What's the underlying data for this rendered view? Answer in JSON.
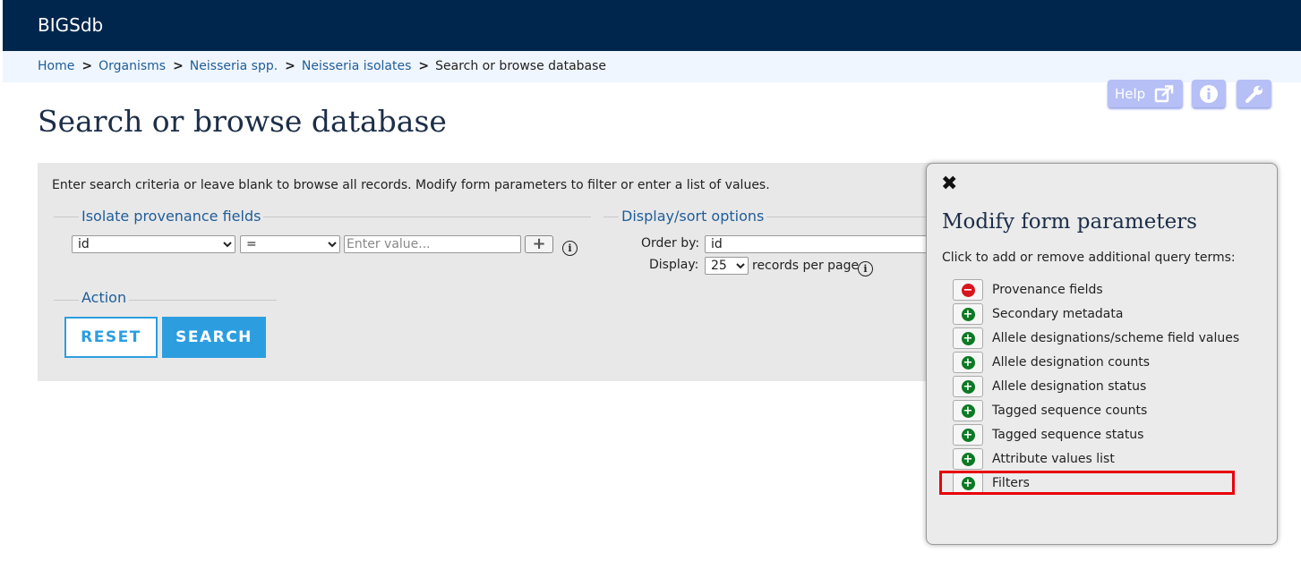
{
  "app": {
    "brand": "BIGSdb"
  },
  "breadcrumb": {
    "links": [
      "Home",
      "Organisms",
      "Neisseria spp.",
      "Neisseria isolates"
    ],
    "current": "Search or browse database",
    "separator": ">"
  },
  "toolbar": {
    "help_label": "Help",
    "icons": [
      "external-link-icon",
      "info-icon",
      "wrench-icon"
    ]
  },
  "page": {
    "title": "Search or browse database"
  },
  "search_form": {
    "intro": "Enter search criteria or leave blank to browse all records. Modify form parameters to filter or enter a list of values.",
    "provenance": {
      "legend": "Isolate provenance fields",
      "field_value": "id",
      "operator_value": "=",
      "value_placeholder": "Enter value...",
      "add_symbol": "+"
    },
    "display_sort": {
      "legend": "Display/sort options",
      "order_by_label": "Order by:",
      "order_by_value": "id",
      "display_label": "Display:",
      "display_value": "25",
      "records_suffix": "records per page"
    },
    "action": {
      "legend": "Action",
      "reset_label": "RESET",
      "search_label": "SEARCH"
    }
  },
  "modify_panel": {
    "close_symbol": "✖",
    "title": "Modify form parameters",
    "hint": "Click to add or remove additional query terms:",
    "options": [
      {
        "label": "Provenance fields",
        "state": "remove",
        "symbol": "−"
      },
      {
        "label": "Secondary metadata",
        "state": "add",
        "symbol": "+"
      },
      {
        "label": "Allele designations/scheme field values",
        "state": "add",
        "symbol": "+"
      },
      {
        "label": "Allele designation counts",
        "state": "add",
        "symbol": "+"
      },
      {
        "label": "Allele designation status",
        "state": "add",
        "symbol": "+"
      },
      {
        "label": "Tagged sequence counts",
        "state": "add",
        "symbol": "+"
      },
      {
        "label": "Tagged sequence status",
        "state": "add",
        "symbol": "+"
      },
      {
        "label": "Attribute values list",
        "state": "add",
        "symbol": "+"
      },
      {
        "label": "Filters",
        "state": "add",
        "symbol": "+"
      }
    ]
  },
  "colors": {
    "topbar": "#00264d",
    "breadcrumb_bg": "#f0f6ff",
    "link": "#1f5d99",
    "accent": "#2c9ee0",
    "add_icon": "#0b7a23",
    "remove_icon": "#d8151c",
    "highlight": "#e8000b"
  }
}
